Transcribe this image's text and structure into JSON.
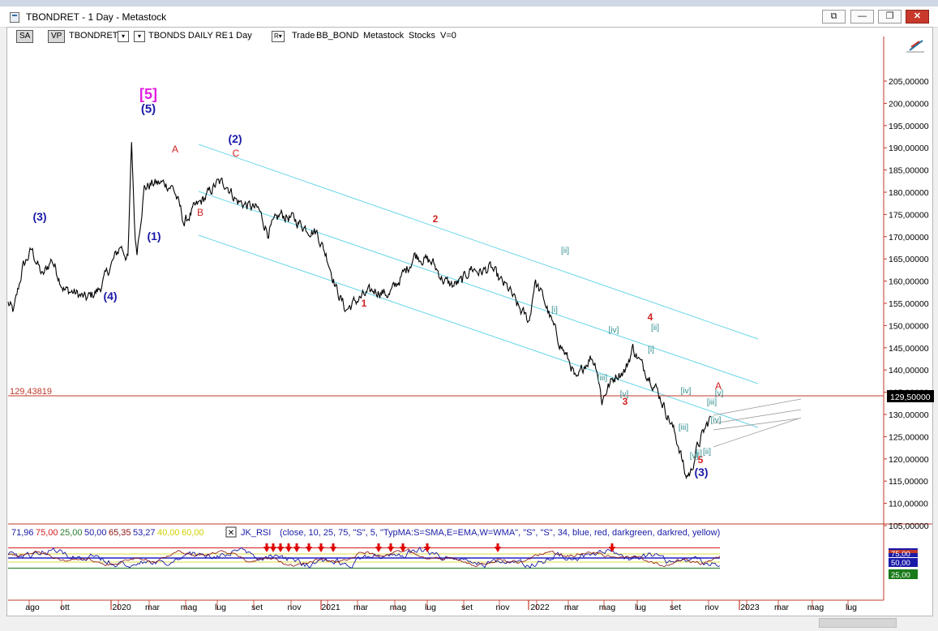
{
  "window": {
    "title": "TBONDRET - 1 Day - Metastock",
    "controls": [
      "⧉",
      "—",
      "❐",
      "✕"
    ]
  },
  "toolbar": {
    "sa_label": "SA",
    "vp_label": "VP",
    "symbol": "TBONDRET",
    "dropdown_glyph": "▾",
    "dataset": "TBONDS DAILY RE",
    "period": "1 Day",
    "r_label": "R",
    "mode": "Trade",
    "indicator_set": "BB_BOND",
    "source": "Metastock",
    "asset_class": "Stocks",
    "volume": "V=0"
  },
  "price_panel": {
    "y_labels": [
      "205,00000",
      "200,00000",
      "195,00000",
      "190,00000",
      "185,00000",
      "180,00000",
      "175,00000",
      "170,00000",
      "165,00000",
      "160,00000",
      "155,00000",
      "150,00000",
      "145,00000",
      "140,00000",
      "135,00000",
      "130,00000",
      "125,00000",
      "120,00000",
      "115,00000",
      "110,00000",
      "105,00000"
    ],
    "current_price_right": "129,50000",
    "current_price_left": "129,43819",
    "wave_labels": [
      {
        "t": "[5]",
        "c": "#e020e0"
      },
      {
        "t": "(5)",
        "c": "#1a1aa8"
      },
      {
        "t": "(3)",
        "c": "#1a1aa8"
      },
      {
        "t": "(4)",
        "c": "#1a1aa8"
      },
      {
        "t": "(1)",
        "c": "#1a1aa8"
      },
      {
        "t": "(2)",
        "c": "#1a1aa8"
      },
      {
        "t": "(3)",
        "c": "#1a1aa8"
      },
      {
        "t": "A",
        "c": "#d22020"
      },
      {
        "t": "B",
        "c": "#d22020"
      },
      {
        "t": "C",
        "c": "#d22020"
      },
      {
        "t": "1",
        "c": "#d22020"
      },
      {
        "t": "2",
        "c": "#d22020"
      },
      {
        "t": "3",
        "c": "#d22020"
      },
      {
        "t": "4",
        "c": "#d22020"
      },
      {
        "t": "5",
        "c": "#d22020"
      },
      {
        "t": "A",
        "c": "#d22020"
      },
      {
        "t": "[ii]",
        "c": "#2e8b8b"
      },
      {
        "t": "[i]",
        "c": "#2e8b8b"
      },
      {
        "t": "[iv]",
        "c": "#2e8b8b"
      },
      {
        "t": "[iii]",
        "c": "#2e8b8b"
      },
      {
        "t": "[v]",
        "c": "#2e8b8b"
      },
      {
        "t": "[ii]",
        "c": "#2e8b8b"
      },
      {
        "t": "[i]",
        "c": "#2e8b8b"
      },
      {
        "t": "[iv]",
        "c": "#2e8b8b"
      },
      {
        "t": "[iii]",
        "c": "#2e8b8b"
      },
      {
        "t": "[v]",
        "c": "#2e8b8b"
      },
      {
        "t": "[i]",
        "c": "#2e8b8b"
      },
      {
        "t": "[ii]",
        "c": "#2e8b8b"
      },
      {
        "t": "[iii]",
        "c": "#2e8b8b"
      },
      {
        "t": "[iv]",
        "c": "#2e8b8b"
      },
      {
        "t": "[v]",
        "c": "#2e8b8b"
      }
    ]
  },
  "indicator_panel": {
    "values": [
      {
        "t": "71,96",
        "c": "#1a1aa8"
      },
      {
        "t": "75,00",
        "c": "#d22020"
      },
      {
        "t": "25,00",
        "c": "#2a7a2a"
      },
      {
        "t": "50,00",
        "c": "#1a1aa8"
      },
      {
        "t": "65,35",
        "c": "#8b1010"
      },
      {
        "t": "53,27",
        "c": "#1a1aa8"
      },
      {
        "t": "40,00",
        "c": "#d0d000"
      },
      {
        "t": "60,00",
        "c": "#d0d000"
      }
    ],
    "close_glyph": "✕",
    "name": "JK_RSI",
    "params": "(close,  10,  25,  75,  \"S\",  5,  \"TypMA:S=SMA,E=EMA,W=WMA\",  \"S\",  \"S\",  34,  blue,  red,  darkgreen,  darkred,  yellow)",
    "right_labels": [
      "75,00",
      "50,00",
      "25,00"
    ]
  },
  "x_axis": {
    "labels": [
      "ago",
      "ott",
      "2020",
      "mar",
      "mag",
      "lug",
      "set",
      "nov",
      "2021",
      "mar",
      "mag",
      "lug",
      "set",
      "nov",
      "2022",
      "mar",
      "mag",
      "lug",
      "set",
      "nov",
      "2023",
      "mar",
      "mag",
      "lug"
    ]
  },
  "chart_data": {
    "type": "line",
    "title": "",
    "series": [
      {
        "name": "",
        "anchors": [
          [
            0,
            155
          ],
          [
            0.3,
            153
          ],
          [
            0.8,
            163
          ],
          [
            1.3,
            167
          ],
          [
            1.9,
            161
          ],
          [
            2.4,
            165
          ],
          [
            3.1,
            158
          ],
          [
            3.6,
            157.5
          ],
          [
            4.3,
            156
          ],
          [
            5.0,
            158
          ],
          [
            5.6,
            163
          ],
          [
            6.2,
            168
          ],
          [
            6.6,
            165
          ],
          [
            6.8,
            191
          ],
          [
            7.0,
            169
          ],
          [
            7.1,
            167
          ],
          [
            7.5,
            181
          ],
          [
            8.0,
            182
          ],
          [
            8.6,
            182
          ],
          [
            9.1,
            181
          ],
          [
            9.5,
            176
          ],
          [
            9.7,
            173
          ],
          [
            10.2,
            176
          ],
          [
            10.9,
            179
          ],
          [
            11.5,
            182
          ],
          [
            12.0,
            182
          ],
          [
            12.6,
            178
          ],
          [
            13.2,
            177
          ],
          [
            13.8,
            176
          ],
          [
            14.3,
            171
          ],
          [
            15.0,
            175
          ],
          [
            15.7,
            174
          ],
          [
            16.4,
            172
          ],
          [
            17.0,
            171
          ],
          [
            17.6,
            165
          ],
          [
            18.1,
            158
          ],
          [
            18.6,
            153.5
          ],
          [
            19.3,
            156
          ],
          [
            20.2,
            158
          ],
          [
            21.0,
            157
          ],
          [
            21.5,
            160
          ],
          [
            22.0,
            163
          ],
          [
            22.4,
            166
          ],
          [
            22.9,
            165
          ],
          [
            23.4,
            164
          ],
          [
            24.0,
            160
          ],
          [
            24.5,
            159
          ],
          [
            25.0,
            160
          ],
          [
            25.5,
            163
          ],
          [
            26.0,
            162
          ],
          [
            26.6,
            163
          ],
          [
            27.1,
            160
          ],
          [
            27.6,
            158
          ],
          [
            28.1,
            154
          ],
          [
            28.7,
            151
          ],
          [
            29.0,
            160
          ],
          [
            29.5,
            156
          ],
          [
            30.0,
            150
          ],
          [
            30.5,
            145
          ],
          [
            31.0,
            141
          ],
          [
            31.3,
            137
          ],
          [
            31.7,
            141
          ],
          [
            32.1,
            143
          ],
          [
            32.4,
            141
          ],
          [
            32.7,
            133
          ],
          [
            33.0,
            136
          ],
          [
            33.5,
            139
          ],
          [
            34.0,
            140
          ],
          [
            34.4,
            145
          ],
          [
            34.9,
            141
          ],
          [
            35.4,
            138
          ],
          [
            35.8,
            135
          ],
          [
            36.2,
            131
          ],
          [
            36.6,
            127
          ],
          [
            37.0,
            122
          ],
          [
            37.3,
            116
          ],
          [
            37.6,
            117
          ],
          [
            37.9,
            122
          ],
          [
            38.3,
            126
          ],
          [
            38.7,
            129.5
          ]
        ]
      }
    ],
    "overlays": {
      "channels": [
        "upper",
        "middle",
        "lower"
      ],
      "resistance_price": 129.43819,
      "rsi_levels": [
        75,
        50,
        25
      ]
    },
    "ylim": [
      100,
      210
    ],
    "xlabel": "",
    "ylabel": ""
  }
}
